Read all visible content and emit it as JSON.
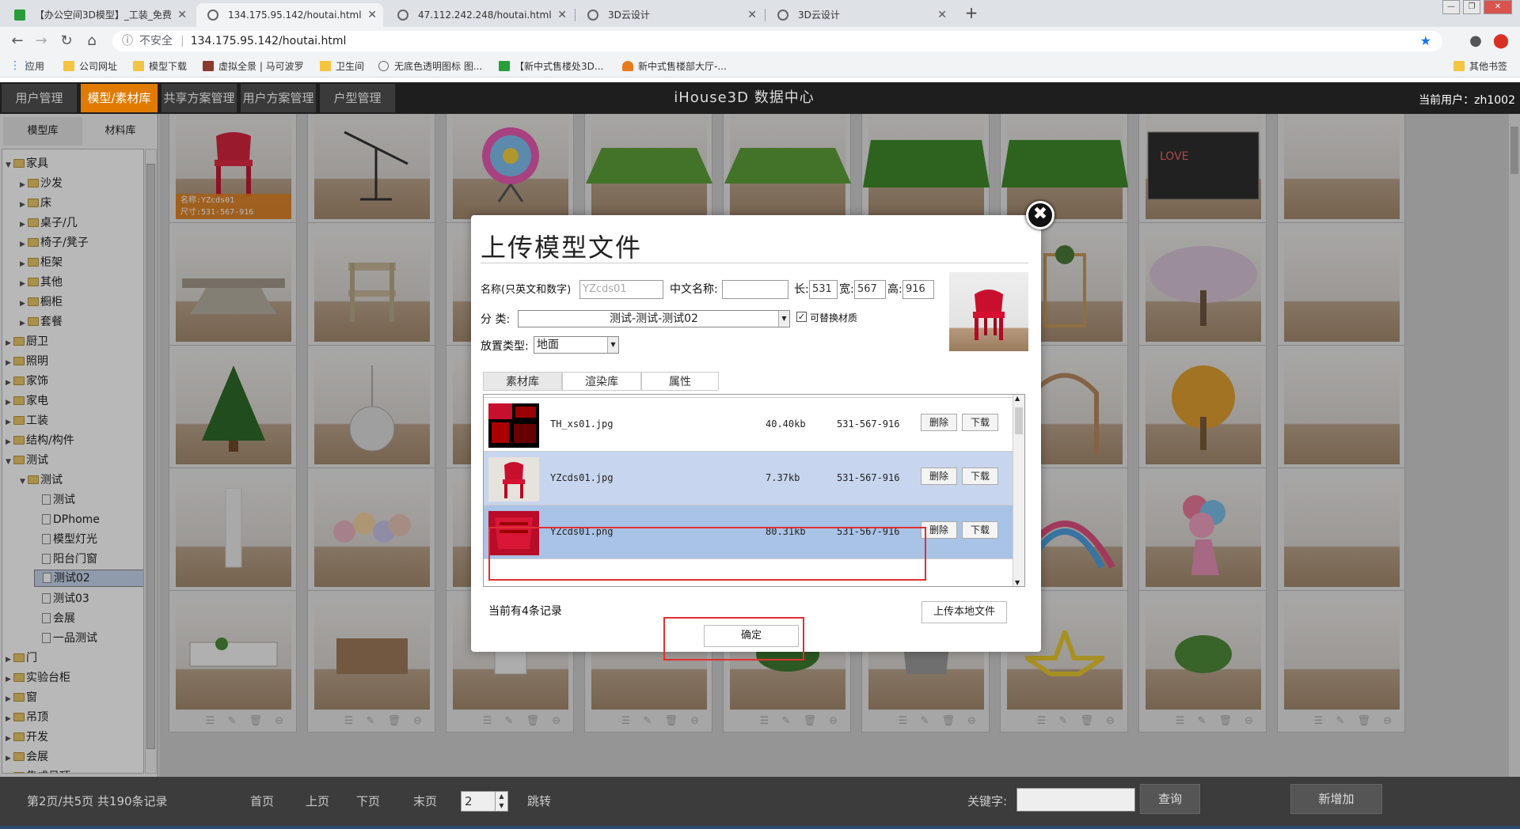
{
  "browser": {
    "tabs": [
      {
        "title": "【办公空间3D模型】_工装_免费"
      },
      {
        "title": "134.175.95.142/houtai.html"
      },
      {
        "title": "47.112.242.248/houtai.html"
      },
      {
        "title": "3D云设计"
      },
      {
        "title": "3D云设计"
      }
    ],
    "address": {
      "security": "不安全",
      "url": "134.175.95.142/houtai.html"
    },
    "bookmarks": [
      "应用",
      "公司网址",
      "模型下载",
      "虚拟全景 | 马可波罗",
      "卫生间",
      "无底色透明图标 图...",
      "【新中式售楼处3D...",
      "新中式售楼部大厅-..."
    ],
    "other_bookmarks": "其他书签"
  },
  "app": {
    "menu": [
      "用户管理",
      "模型/素材库",
      "共享方案管理",
      "用户方案管理",
      "户型管理"
    ],
    "title": "iHouse3D 数据中心",
    "current_user": "当前用户：zh1002",
    "accent": "#e07b00"
  },
  "sidebar": {
    "tabs": [
      "模型库",
      "材料库"
    ],
    "tree": [
      {
        "label": "家具",
        "type": "folder",
        "level": 0,
        "open": true
      },
      {
        "label": "沙发",
        "type": "folder",
        "level": 1
      },
      {
        "label": "床",
        "type": "folder",
        "level": 1
      },
      {
        "label": "桌子/几",
        "type": "folder",
        "level": 1
      },
      {
        "label": "椅子/凳子",
        "type": "folder",
        "level": 1
      },
      {
        "label": "柜架",
        "type": "folder",
        "level": 1
      },
      {
        "label": "其他",
        "type": "folder",
        "level": 1
      },
      {
        "label": "橱柜",
        "type": "folder",
        "level": 1
      },
      {
        "label": "套餐",
        "type": "folder",
        "level": 1
      },
      {
        "label": "厨卫",
        "type": "folder",
        "level": 0
      },
      {
        "label": "照明",
        "type": "folder",
        "level": 0
      },
      {
        "label": "家饰",
        "type": "folder",
        "level": 0
      },
      {
        "label": "家电",
        "type": "folder",
        "level": 0
      },
      {
        "label": "工装",
        "type": "folder",
        "level": 0
      },
      {
        "label": "结构/构件",
        "type": "folder",
        "level": 0
      },
      {
        "label": "测试",
        "type": "folder",
        "level": 0,
        "open": true
      },
      {
        "label": "测试",
        "type": "folder",
        "level": 1,
        "open": true
      },
      {
        "label": "测试",
        "type": "doc",
        "level": 2
      },
      {
        "label": "DPhome",
        "type": "doc",
        "level": 2
      },
      {
        "label": "模型灯光",
        "type": "doc",
        "level": 2
      },
      {
        "label": "阳台门窗",
        "type": "doc",
        "level": 2
      },
      {
        "label": "测试02",
        "type": "doc",
        "level": 2,
        "selected": true
      },
      {
        "label": "测试03",
        "type": "doc",
        "level": 2
      },
      {
        "label": "会展",
        "type": "doc",
        "level": 2
      },
      {
        "label": "一品测试",
        "type": "doc",
        "level": 2
      },
      {
        "label": "门",
        "type": "folder",
        "level": 0
      },
      {
        "label": "实验台柜",
        "type": "folder",
        "level": 0
      },
      {
        "label": "窗",
        "type": "folder",
        "level": 0
      },
      {
        "label": "吊顶",
        "type": "folder",
        "level": 0
      },
      {
        "label": "开发",
        "type": "folder",
        "level": 0
      },
      {
        "label": "会展",
        "type": "folder",
        "level": 0
      },
      {
        "label": "集成吊顶",
        "type": "folder",
        "level": 0
      }
    ]
  },
  "grid": {
    "first_card": {
      "name": "名称:YZcds01",
      "size": "尺寸:531-567-916"
    },
    "card_actions": "☰ ✎ 🗑 ⊖"
  },
  "dialog": {
    "title": "上传模型文件",
    "name_label": "名称(只英文和数字)",
    "name_value": "YZcds01",
    "cn_label": "中文名称:",
    "cn_value": "",
    "len_label": "长:",
    "len_value": "531",
    "wid_label": "宽:",
    "wid_value": "567",
    "hei_label": "高:",
    "hei_value": "916",
    "cat_label": "分 类:",
    "cat_value": "测试-测试-测试02",
    "replace_label": "可替换材质",
    "place_label": "放置类型:",
    "place_value": "地面",
    "tabs": [
      "素材库",
      "渲染库",
      "属性"
    ],
    "files": [
      {
        "name": "TH_xs01.jpg",
        "size": "40.40kb",
        "dims": "531-567-916"
      },
      {
        "name": "YZcds01.jpg",
        "size": "7.37kb",
        "dims": "531-567-916"
      },
      {
        "name": "YZcds01.png",
        "size": "80.31kb",
        "dims": "531-567-916"
      }
    ],
    "delete_label": "删除",
    "download_label": "下载",
    "record_count": "当前有4条记录",
    "upload_local": "上传本地文件",
    "confirm": "确定"
  },
  "footer": {
    "page_info": "第2页/共5页 共190条记录",
    "first": "首页",
    "prev": "上页",
    "next": "下页",
    "last": "末页",
    "page_input": "2",
    "jump": "跳转",
    "keyword_label": "关键字:",
    "search": "查询",
    "add": "新增加"
  }
}
